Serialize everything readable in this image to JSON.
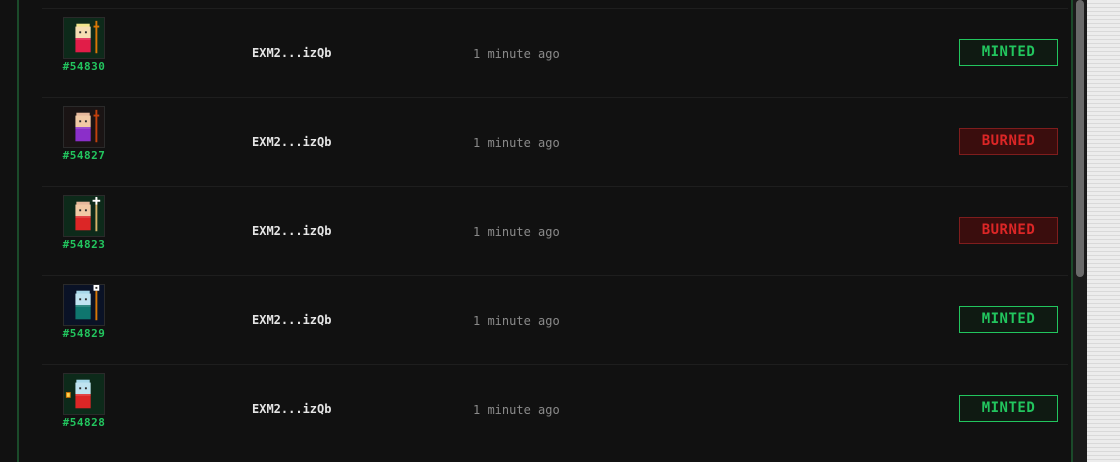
{
  "activity": {
    "rows": [
      {
        "token_id": "#54830",
        "address": "EXM2...izQb",
        "time": "1 minute ago",
        "status": "MINTED",
        "variant": "minted",
        "bg": "#0d2a1a",
        "head": "#f5deb3",
        "hair": "#f0e68c",
        "body": "#e11d48",
        "accessory": "#d97706",
        "acc": "staff"
      },
      {
        "token_id": "#54827",
        "address": "EXM2...izQb",
        "time": "1 minute ago",
        "status": "BURNED",
        "variant": "burned",
        "bg": "#1a1414",
        "head": "#f1c9a5",
        "hair": "#e6b89c",
        "body": "#8b2fc9",
        "accessory": "#c2410c",
        "acc": "staff"
      },
      {
        "token_id": "#54823",
        "address": "EXM2...izQb",
        "time": "1 minute ago",
        "status": "BURNED",
        "variant": "burned",
        "bg": "#0d2a1a",
        "head": "#f1c9a5",
        "hair": "#e6b89c",
        "body": "#dc2626",
        "accessory": "#d6b36a",
        "acc": "cross"
      },
      {
        "token_id": "#54829",
        "address": "EXM2...izQb",
        "time": "1 minute ago",
        "status": "MINTED",
        "variant": "minted",
        "bg": "#0a1226",
        "head": "#bfe3f0",
        "hair": "#a7d8ea",
        "body": "#0f766e",
        "accessory": "#d97706",
        "acc": "orb"
      },
      {
        "token_id": "#54828",
        "address": "EXM2...izQb",
        "time": "1 minute ago",
        "status": "MINTED",
        "variant": "minted",
        "bg": "#0d2a1a",
        "head": "#bfe3f0",
        "hair": "#a7d8ea",
        "body": "#dc2626",
        "accessory": "#d97706",
        "acc": "lantern"
      }
    ]
  }
}
